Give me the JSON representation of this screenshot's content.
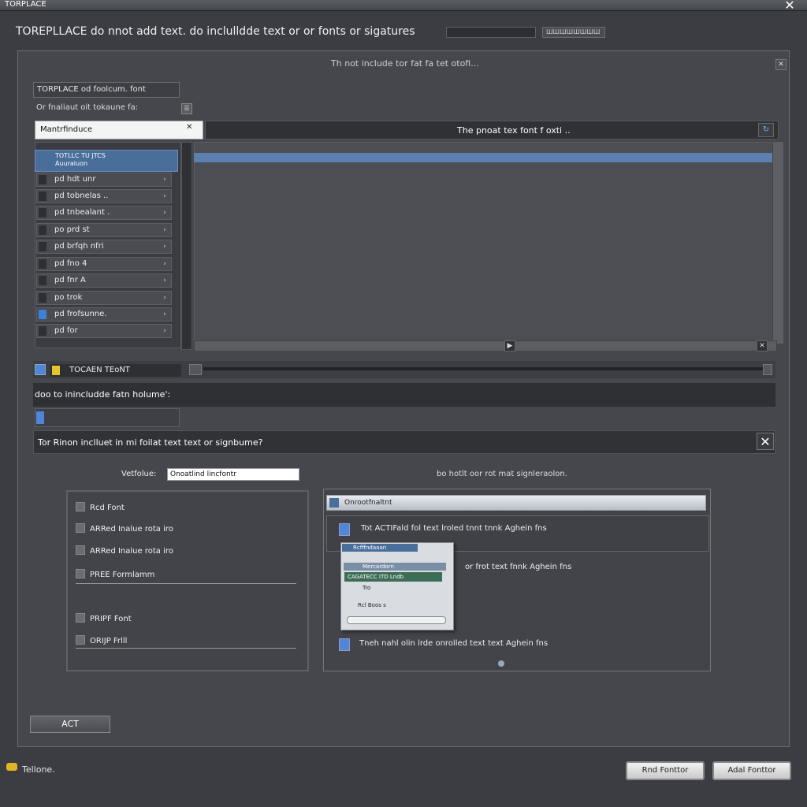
{
  "window": {
    "title": "TORPLACE",
    "close_label": "✕"
  },
  "header": {
    "title": "TOREPLLACE do nnot add text. do inclulldde text or or fonts or sigatures",
    "field_right_value": "ШШШШШШШШ"
  },
  "panel": {
    "header_text": "Th not include tor fat fa tet otofi...",
    "corner_close": "✕"
  },
  "tab": {
    "label": "TORPLACE   od foolcum. font"
  },
  "sublabel": {
    "text": "Or fnaliaut oit tokaune fa:"
  },
  "search": {
    "value": "Mantrfinduce",
    "clear_label": "✕"
  },
  "right_header": {
    "text": "The pnoat tex font f oxti ..",
    "button": "↻"
  },
  "list": {
    "selected_text": "TOTLLC TU JTCS\nAuuraluon",
    "items": [
      {
        "label": "pd hdt unr"
      },
      {
        "label": "pd tobnelas .."
      },
      {
        "label": "pd tnbealant ."
      },
      {
        "label": "po prd st"
      },
      {
        "label": "pd brfqh nfri"
      },
      {
        "label": "pd fno      4"
      },
      {
        "label": "pd fnr A"
      },
      {
        "label": "po trok"
      },
      {
        "label": "pd frofsunne."
      },
      {
        "label": "pd for"
      }
    ]
  },
  "section": {
    "label": "TOCAEN TEoNT"
  },
  "question1": {
    "text": "doo to inincludde fatn holume':"
  },
  "question2": {
    "text": "Tor Rinon inclluet in mi foilat text text or signbume?",
    "close": "✕"
  },
  "form": {
    "field_label": "Vetfolue:",
    "field_value": "Onoatlind lincfontr",
    "right_note": "bo hotlt oor rot mat signleraolon."
  },
  "options": [
    {
      "label": "Rcd Font"
    },
    {
      "label": "ARRed Inalue rota iro"
    },
    {
      "label": "ARRed Inalue rota iro"
    },
    {
      "label": "PREE  Formlamm"
    },
    {
      "label": "PRIPF   Font"
    },
    {
      "label": "ORIJP    Frlll"
    }
  ],
  "listbox": {
    "header": "Onrootfnaltnt",
    "rows": [
      {
        "label": "Tot ACTIFald fol text lroled   tnnt   tnnk   Aghein fns"
      },
      {
        "label": "or   frot   text   fnnk   Aghein fns"
      },
      {
        "label": "Tneh nahl olin lrde onrolled   text   text   Aghein fns"
      }
    ]
  },
  "popup": {
    "title": "Rcfffndaaan",
    "line": "Mercardorn",
    "chip": "CAGATECC  ITD  Lndb",
    "text1": "Tro",
    "text2": "Rcl  Boos  s"
  },
  "actions": {
    "act_label": "ACT",
    "status_text": "Tellone.",
    "btn_left": "Rnd Fonttor",
    "btn_right": "Adal Fonttor"
  },
  "colors": {
    "accent": "#4a6e9a",
    "selection": "#5b7fae",
    "background": "#3b3d42"
  }
}
